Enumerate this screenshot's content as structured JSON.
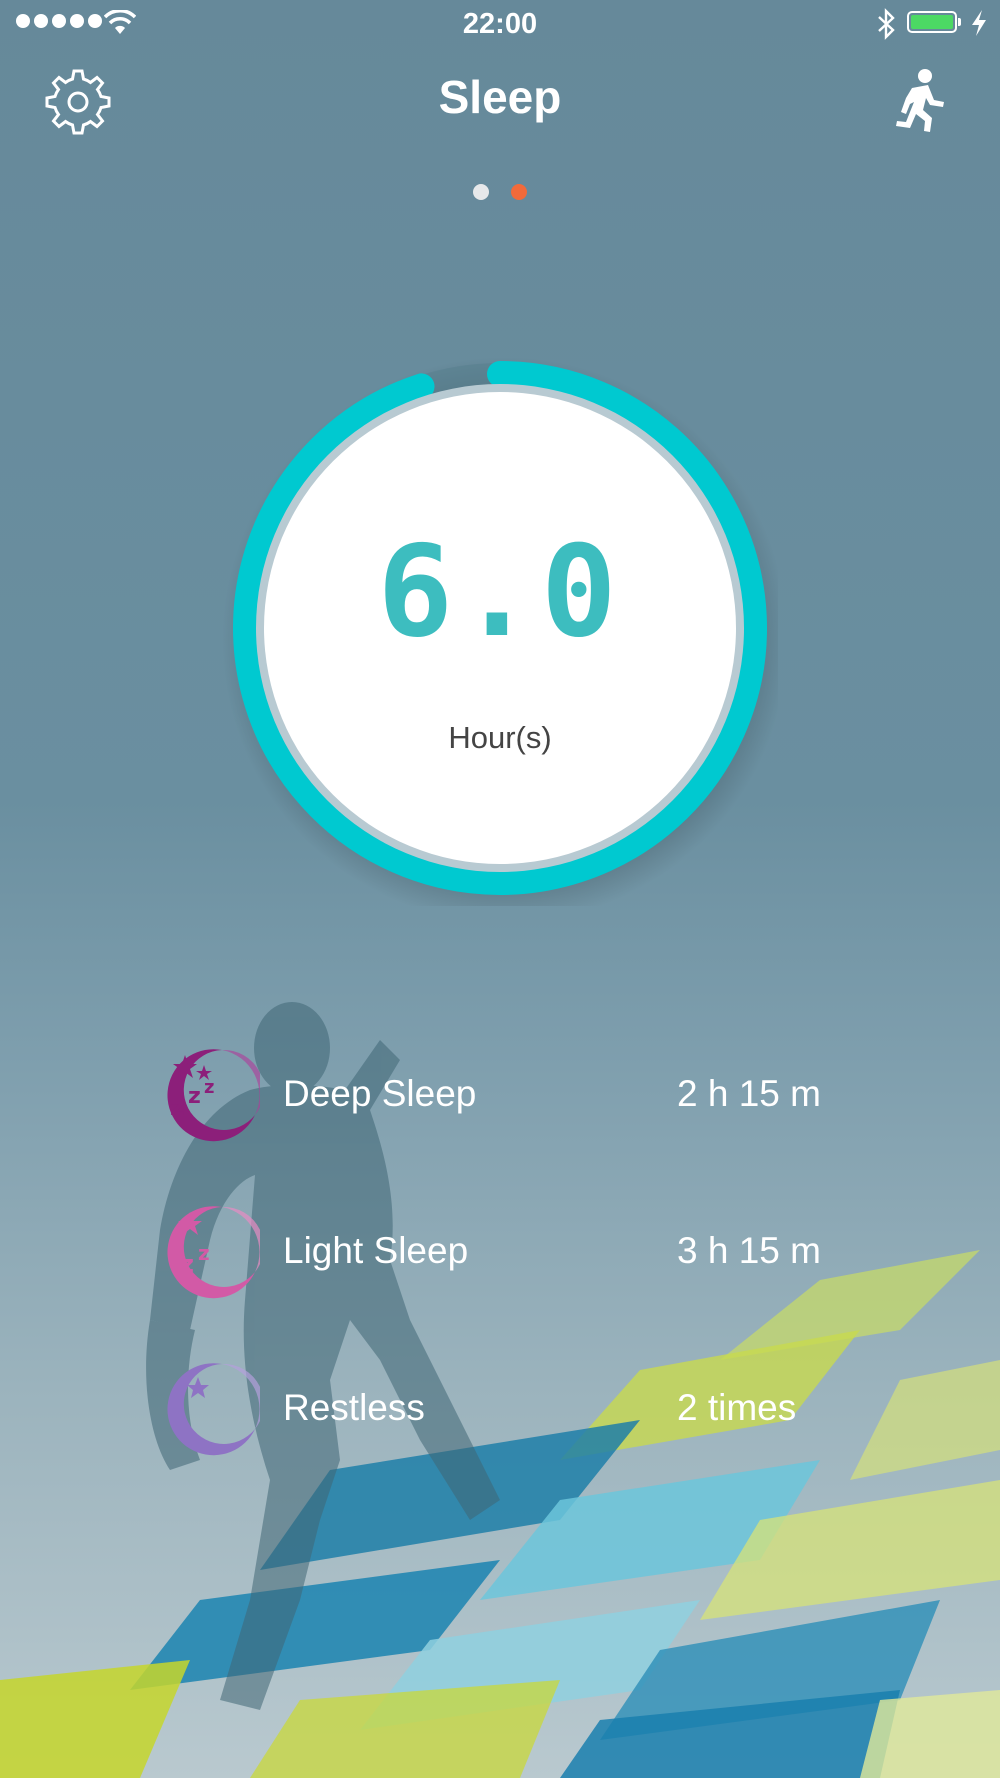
{
  "status_bar": {
    "time": "22:00",
    "signal_bars": 5,
    "battery_level": 1.0,
    "charging": true,
    "icons": [
      "wifi-icon",
      "bluetooth-icon",
      "battery-icon",
      "charging-icon"
    ]
  },
  "header": {
    "title": "Sleep",
    "left_icon": "gear-icon",
    "right_icon": "running-person-icon"
  },
  "pager": {
    "page_count": 2,
    "current_page": 2,
    "active_color": "#f26a3a",
    "inactive_color": "#e6e8ea"
  },
  "summary": {
    "value": "6.0",
    "unit": "Hour(s)",
    "ring_progress": 0.95,
    "ring_color": "#00c9d0"
  },
  "stats": [
    {
      "icon": "deep-sleep-moon-icon",
      "label": "Deep Sleep",
      "value": "2 h 15 m",
      "color": "#8c1f7a"
    },
    {
      "icon": "light-sleep-moon-icon",
      "label": "Light Sleep",
      "value": "3 h 15 m",
      "color": "#d25aa6"
    },
    {
      "icon": "restless-moon-icon",
      "label": "Restless",
      "value": "2 times",
      "color": "#8e73c4"
    }
  ]
}
